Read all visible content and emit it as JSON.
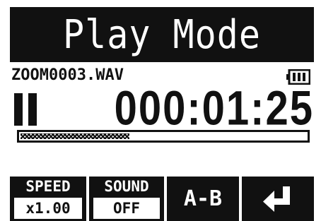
{
  "header": {
    "title": "Play Mode"
  },
  "file": {
    "name": "ZOOM0003.WAV"
  },
  "status": {
    "icon": "pause-icon",
    "time": "000:01:25",
    "battery_icon": "battery-icon"
  },
  "progress": {
    "fraction": 0.38
  },
  "buttons": {
    "speed": {
      "label": "SPEED",
      "value": "x1.00"
    },
    "sound": {
      "label": "SOUND",
      "value": "OFF"
    },
    "ab": {
      "label": "A-B"
    },
    "return": {
      "icon": "return-icon"
    }
  },
  "colors": {
    "foreground": "#111111",
    "background": "#ffffff"
  }
}
